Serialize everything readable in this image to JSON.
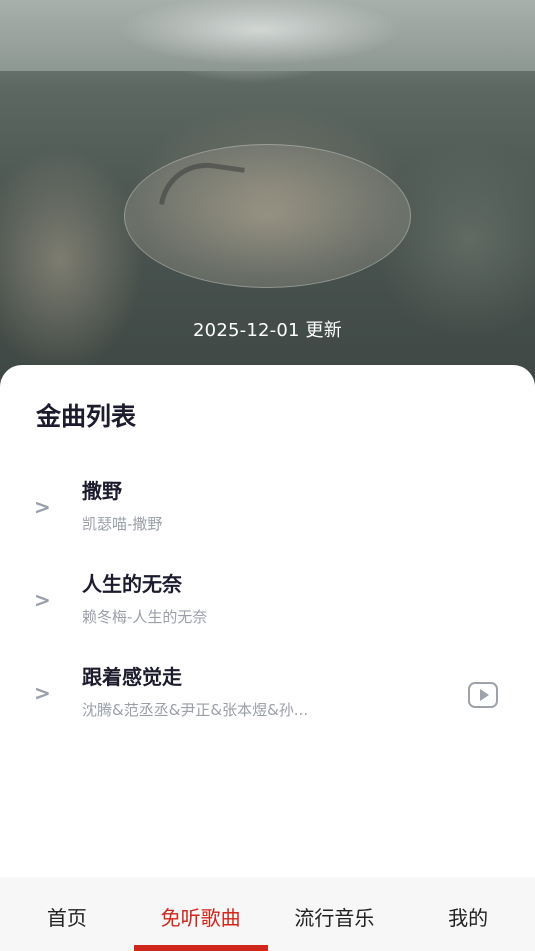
{
  "hero": {
    "update_text": "2025-12-01 更新"
  },
  "list": {
    "title": "金曲列表",
    "chevron": ">",
    "songs": [
      {
        "title": "撒野",
        "subtitle": "凯瑟喵-撒野"
      },
      {
        "title": "人生的无奈",
        "subtitle": "赖冬梅-人生的无奈"
      },
      {
        "title": "跟着感觉走",
        "subtitle": "沈腾&范丞丞&尹正&张本煜&孙..."
      }
    ],
    "play_icon": "play-video-icon"
  },
  "nav": {
    "items": [
      {
        "label": "首页"
      },
      {
        "label": "免听歌曲"
      },
      {
        "label": "流行音乐"
      },
      {
        "label": "我的"
      }
    ],
    "active_index": 1
  },
  "colors": {
    "accent": "#d0271d",
    "title_text": "#1c1c2e",
    "subtitle_text": "#9a9fa8",
    "nav_bg": "#f7f7f7"
  }
}
